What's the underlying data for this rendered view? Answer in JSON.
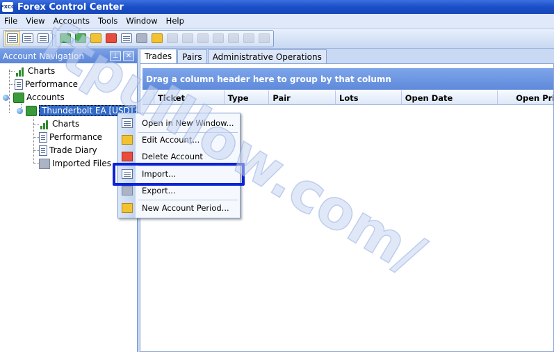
{
  "window": {
    "app_icon_text": "FXCC",
    "title": "Forex Control Center"
  },
  "menu": [
    {
      "label": "File"
    },
    {
      "label": "View"
    },
    {
      "label": "Accounts"
    },
    {
      "label": "Tools"
    },
    {
      "label": "Window"
    },
    {
      "label": "Help"
    }
  ],
  "toolbar": {
    "icons": [
      "account-navigation-icon",
      "search-document-icon",
      "report-icon",
      "account-add-icon",
      "account-refresh-icon",
      "edit-account-icon",
      "delete-account-icon",
      "import-icon",
      "export-icon",
      "new-period-icon",
      "disabled-icons"
    ]
  },
  "left_panel": {
    "title": "Account Navigation",
    "pin_glyph": "⊥",
    "close_glyph": "✕",
    "tree": {
      "charts": "Charts",
      "performance": "Performance",
      "accounts": "Accounts",
      "account": "Thunderbolt EA [USD]",
      "acc_charts": "Charts",
      "acc_performance": "Performance",
      "acc_trade_diary": "Trade Diary",
      "acc_imported_files": "Imported Files"
    }
  },
  "tabs": [
    {
      "label": "Trades",
      "active": true
    },
    {
      "label": "Pairs",
      "active": false
    },
    {
      "label": "Administrative Operations",
      "active": false
    }
  ],
  "grid": {
    "group_hint": "Drag a column header here to group by that column",
    "columns": [
      "Ticket",
      "Type",
      "Pair",
      "Lots",
      "Open Date",
      "Open Price"
    ]
  },
  "context_menu": {
    "items": [
      {
        "label": "Open in New Window..."
      },
      {
        "label": "Edit Account..."
      },
      {
        "label": "Delete Account"
      },
      {
        "label": "Import..."
      },
      {
        "label": "Export..."
      },
      {
        "label": "New Account Period..."
      }
    ]
  },
  "watermark": {
    "text": "ftpulllow.com/",
    "color": "#9fb8e8"
  },
  "colors": {
    "title_bar": "#1a4fc7",
    "highlight": "#0a23d8",
    "selected": "#3169c6"
  }
}
